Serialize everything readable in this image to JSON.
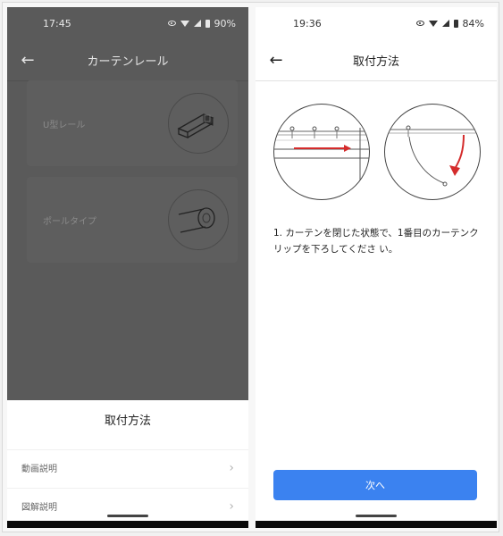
{
  "left": {
    "status": {
      "time": "17:45",
      "battery": "90%"
    },
    "appbar": {
      "title": "カーテンレール"
    },
    "rails": [
      {
        "label": "U型レール"
      },
      {
        "label": "ポールタイプ"
      }
    ],
    "sheet": {
      "title": "取付方法",
      "items": [
        {
          "label": "動画説明"
        },
        {
          "label": "図解説明"
        }
      ]
    }
  },
  "right": {
    "status": {
      "time": "19:36",
      "battery": "84%"
    },
    "appbar": {
      "title": "取付方法"
    },
    "instruction": "1. カーテンを閉じた状態で、1番目のカーテンクリップを下ろしてくださ い。",
    "next_button": "次へ"
  },
  "colors": {
    "accent": "#3b82f0",
    "arrow": "#d42b2b",
    "overlay": "#5a5a5a"
  },
  "icons": {
    "back": "arrow-left-icon",
    "chevron": "chevron-right-icon"
  }
}
